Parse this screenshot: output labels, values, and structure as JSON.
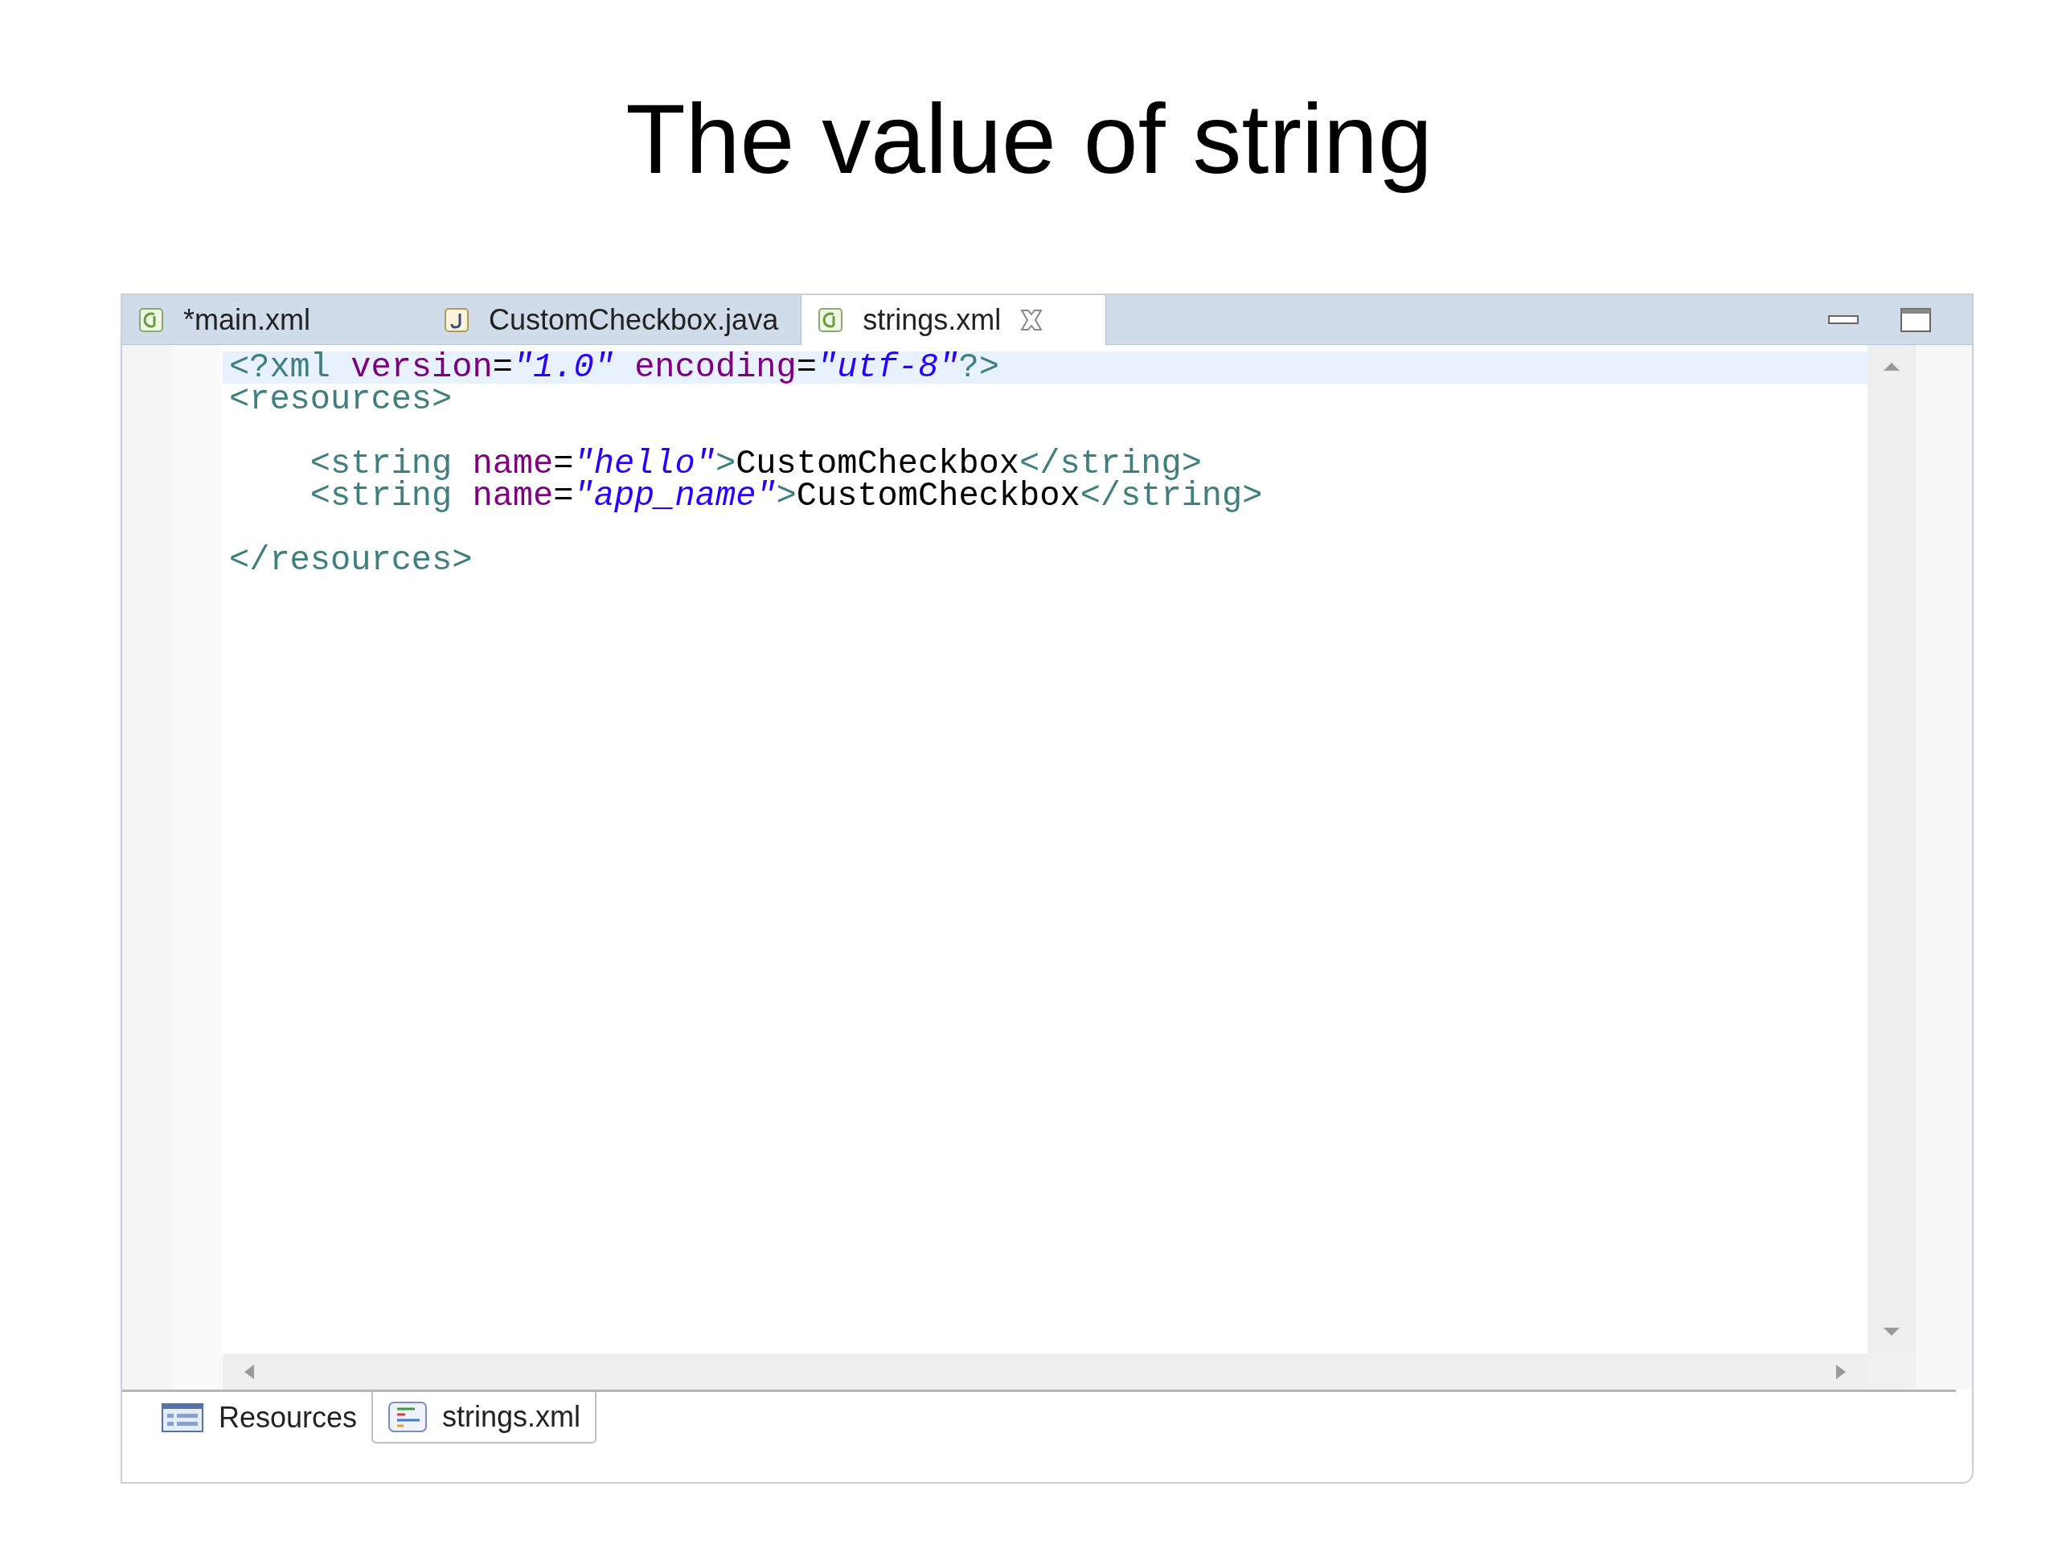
{
  "slide_title": "The value of string",
  "editor_tabs": [
    {
      "label": "*main.xml",
      "kind": "xml",
      "selected": false
    },
    {
      "label": "CustomCheckbox.java",
      "kind": "java",
      "selected": false
    },
    {
      "label": "strings.xml",
      "kind": "xml",
      "selected": true
    }
  ],
  "code_lines": [
    {
      "kind": "code",
      "current": true,
      "tokens": [
        {
          "kind": "tag",
          "text": "<?xml"
        },
        {
          "kind": "attr",
          "text": " version"
        },
        {
          "kind": "text",
          "text": "="
        },
        {
          "kind": "value",
          "text": "\"1.0\""
        },
        {
          "kind": "attr",
          "text": " encoding"
        },
        {
          "kind": "text",
          "text": "="
        },
        {
          "kind": "value",
          "text": "\"utf-8\""
        },
        {
          "kind": "tag",
          "text": "?>"
        }
      ]
    },
    {
      "kind": "code",
      "current": false,
      "tokens": [
        {
          "kind": "tag",
          "text": "<resources>"
        }
      ]
    },
    {
      "kind": "blank",
      "current": false
    },
    {
      "kind": "code",
      "current": false,
      "tokens": [
        {
          "kind": "tag",
          "text": "    <string"
        },
        {
          "kind": "attr",
          "text": " name"
        },
        {
          "kind": "text",
          "text": "="
        },
        {
          "kind": "value",
          "text": "\"hello\""
        },
        {
          "kind": "tag",
          "text": ">"
        },
        {
          "kind": "text",
          "text": "CustomCheckbox"
        },
        {
          "kind": "tag",
          "text": "</string>"
        }
      ]
    },
    {
      "kind": "code",
      "current": false,
      "tokens": [
        {
          "kind": "tag",
          "text": "    <string"
        },
        {
          "kind": "attr",
          "text": " name"
        },
        {
          "kind": "text",
          "text": "="
        },
        {
          "kind": "value",
          "text": "\"app_name\""
        },
        {
          "kind": "tag",
          "text": ">"
        },
        {
          "kind": "text",
          "text": "CustomCheckbox"
        },
        {
          "kind": "tag",
          "text": "</string>"
        }
      ]
    },
    {
      "kind": "blank",
      "current": false
    },
    {
      "kind": "code",
      "current": false,
      "tokens": [
        {
          "kind": "tag",
          "text": "</resources>"
        }
      ]
    }
  ],
  "bottom_tabs": [
    {
      "label": "Resources",
      "kind": "form",
      "selected": false
    },
    {
      "label": "strings.xml",
      "kind": "source",
      "selected": true
    }
  ]
}
